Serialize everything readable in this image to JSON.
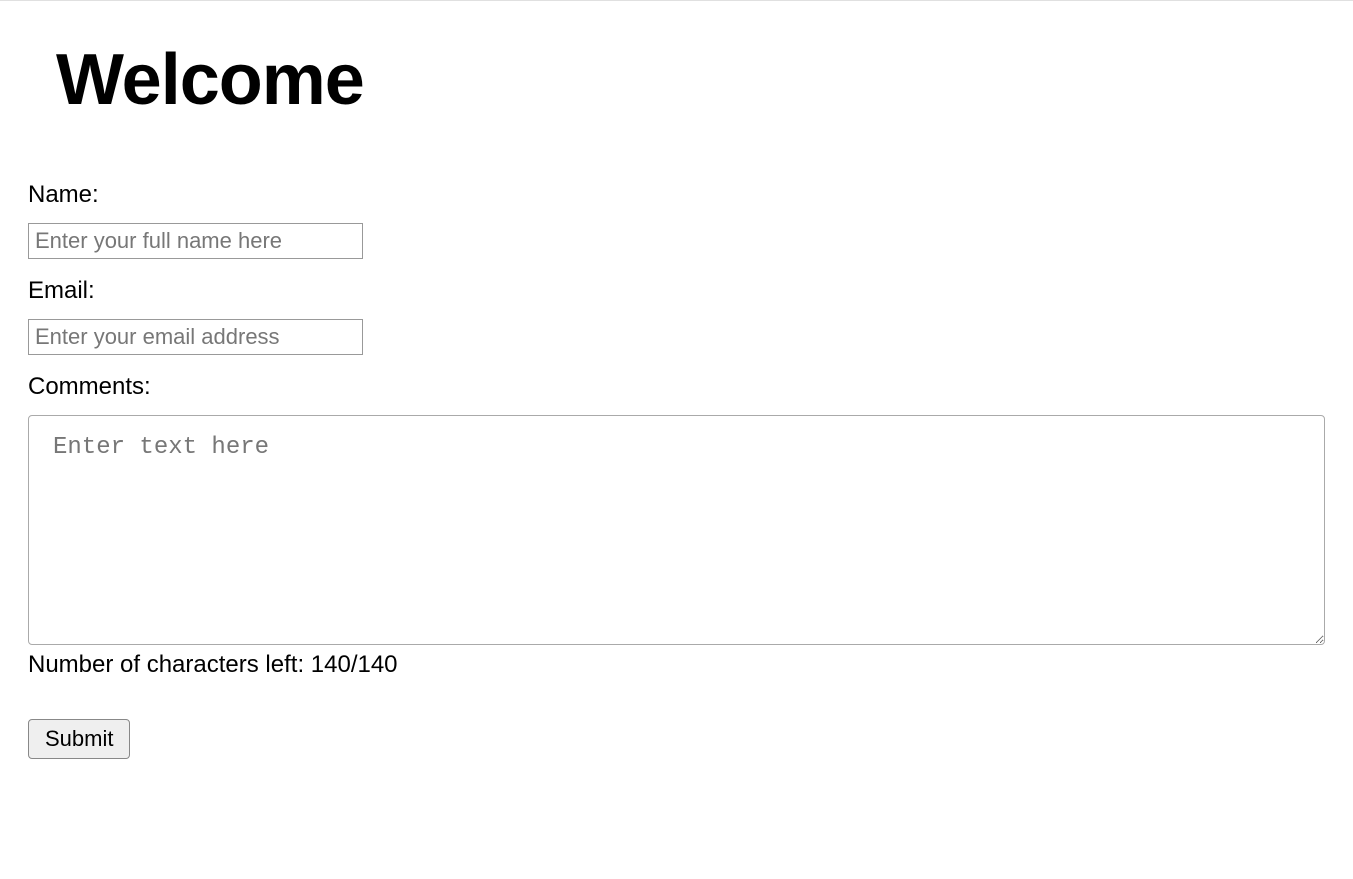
{
  "heading": "Welcome",
  "form": {
    "name": {
      "label": "Name:",
      "placeholder": "Enter your full name here",
      "value": ""
    },
    "email": {
      "label": "Email:",
      "placeholder": "Enter your email address",
      "value": ""
    },
    "comments": {
      "label": "Comments:",
      "placeholder": "Enter text here",
      "value": ""
    },
    "char_count_text": "Number of characters left: 140/140",
    "submit_label": "Submit"
  }
}
